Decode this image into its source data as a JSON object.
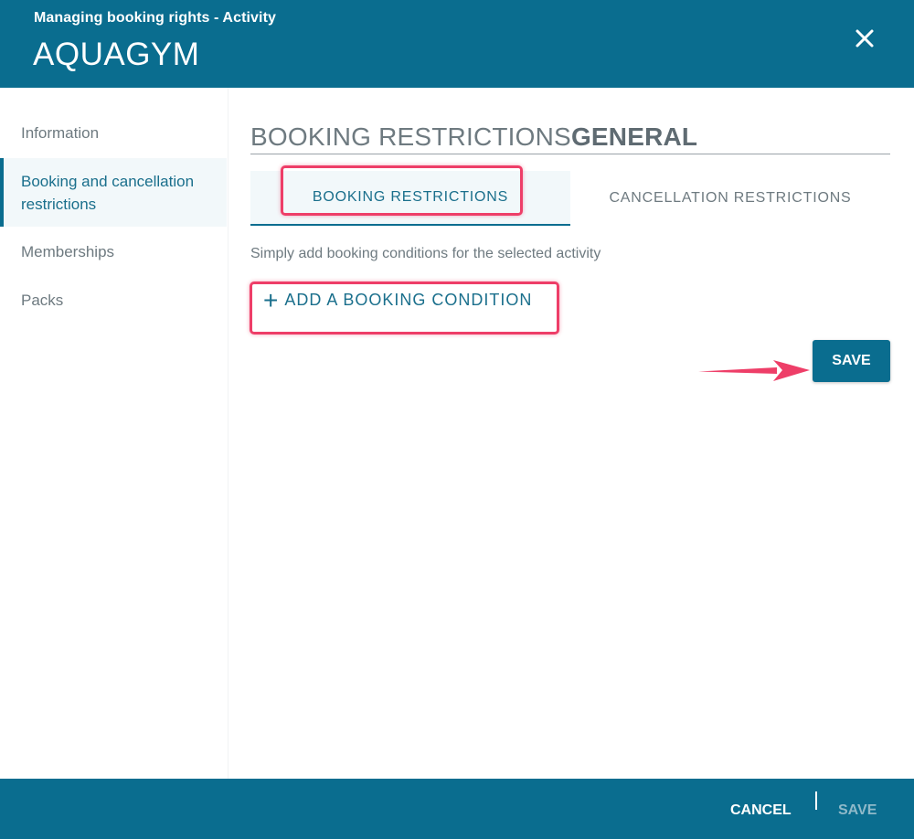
{
  "header": {
    "subtitle": "Managing booking rights - Activity",
    "title": "AQUAGYM",
    "close_icon": "close-icon"
  },
  "sidebar": {
    "items": [
      {
        "label": "Information",
        "active": false
      },
      {
        "label": "Booking and cancellation restrictions",
        "active": true
      },
      {
        "label": "Memberships",
        "active": false
      },
      {
        "label": "Packs",
        "active": false
      }
    ]
  },
  "main": {
    "section_title": "BOOKING RESTRICTIONS",
    "section_title_bold": "GENERAL",
    "tabs": [
      {
        "label": "BOOKING RESTRICTIONS",
        "active": true
      },
      {
        "label": "CANCELLATION RESTRICTIONS",
        "active": false
      }
    ],
    "hint": "Simply add booking conditions for the selected activity",
    "add_condition_label": "ADD A BOOKING CONDITION",
    "add_condition_icon": "plus-icon",
    "save_label": "SAVE"
  },
  "footer": {
    "cancel_label": "CANCEL",
    "save_label": "SAVE"
  },
  "colors": {
    "brand": "#0a6d8f",
    "highlight": "#ee3e68",
    "muted_text": "#6e7a80",
    "active_bg": "#f2f8fa"
  }
}
